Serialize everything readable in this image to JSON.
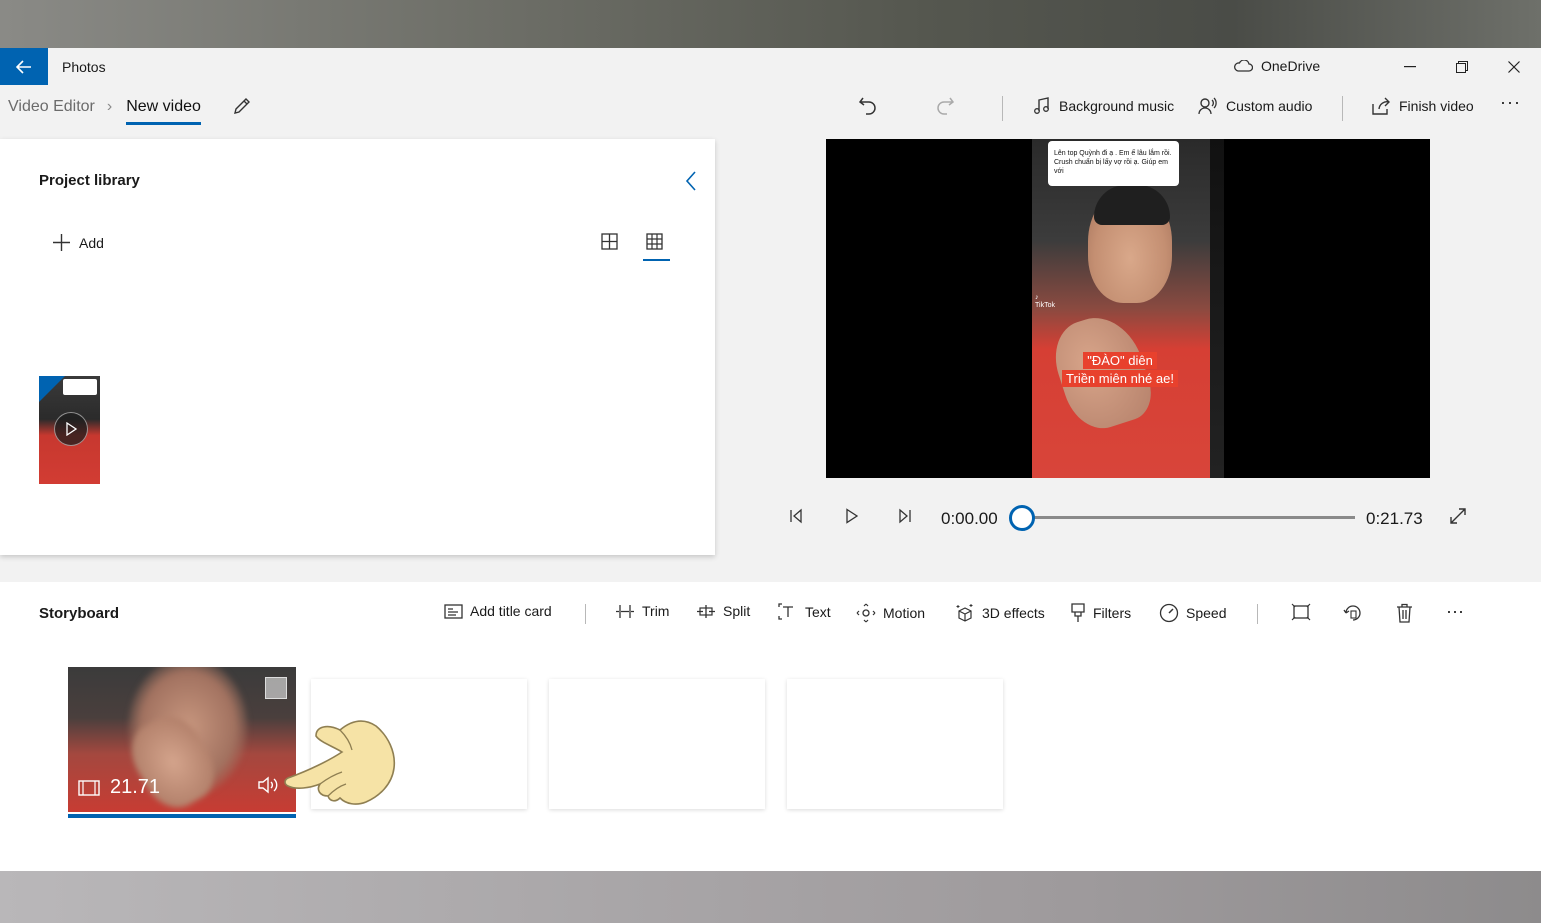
{
  "app": {
    "title": "Photos",
    "cloud_label": "OneDrive"
  },
  "toolbar": {
    "breadcrumb_root": "Video Editor",
    "breadcrumb_current": "New video",
    "background_music": "Background music",
    "custom_audio": "Custom audio",
    "finish_video": "Finish video",
    "more": "···"
  },
  "library": {
    "title": "Project library",
    "add_label": "Add"
  },
  "preview": {
    "bubble_text": "Lên top Quỳnh đi ạ . Em ế lâu lắm rồi. Crush chuẩn bị lấy vợ rồi ạ. Giúp em với",
    "watermark": "TikTok",
    "caption_line1": "\"ĐÀO\" diên",
    "caption_line2": "Triền miên nhé ae!"
  },
  "playback": {
    "current_time": "0:00.00",
    "total_time": "0:21.73",
    "position": 0
  },
  "storyboard": {
    "title": "Storyboard",
    "add_title_card": "Add title card",
    "trim": "Trim",
    "split": "Split",
    "text": "Text",
    "motion": "Motion",
    "effects_3d": "3D effects",
    "filters": "Filters",
    "speed": "Speed",
    "more": "···",
    "clip_duration": "21.71"
  },
  "colors": {
    "accent": "#0063b1"
  },
  "icons": [
    "back-arrow-icon",
    "onedrive-cloud-icon",
    "minimize-icon",
    "restore-icon",
    "close-icon",
    "pencil-icon",
    "undo-icon",
    "redo-icon",
    "music-note-icon",
    "custom-audio-icon",
    "share-icon",
    "chevron-left-icon",
    "plus-icon",
    "grid-large-icon",
    "grid-small-icon",
    "play-icon",
    "previous-frame-icon",
    "next-frame-icon",
    "expand-icon",
    "title-card-icon",
    "trim-icon",
    "split-icon",
    "text-icon",
    "motion-icon",
    "3d-effects-icon",
    "filters-icon",
    "speed-icon",
    "resize-icon",
    "rotate-icon",
    "delete-icon",
    "film-icon",
    "volume-icon",
    "pointing-hand-icon"
  ]
}
